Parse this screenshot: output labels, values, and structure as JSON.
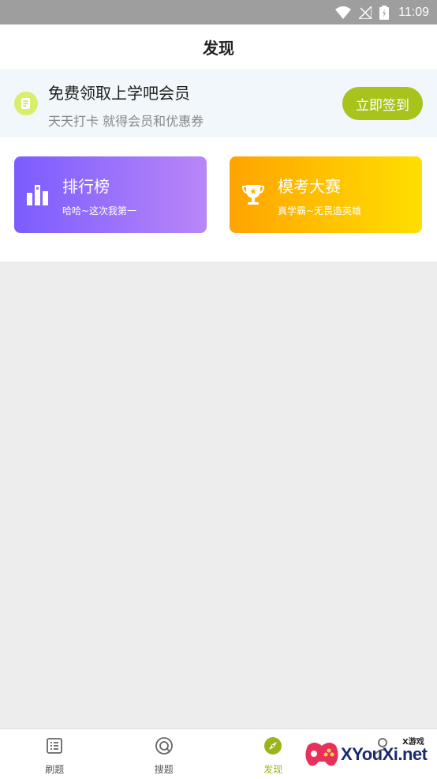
{
  "status_bar": {
    "time": "11:09"
  },
  "header": {
    "title": "发现"
  },
  "banner": {
    "title": "免费领取上学吧会员",
    "subtitle": "天天打卡 就得会员和优惠券",
    "button_label": "立即签到",
    "icon": "checkin-icon"
  },
  "cards": [
    {
      "title": "排行榜",
      "subtitle": "哈哈~这次我第一",
      "icon": "bar-chart-icon"
    },
    {
      "title": "模考大赛",
      "subtitle": "真学霸~无畏造英雄",
      "icon": "trophy-icon"
    }
  ],
  "nav": [
    {
      "label": "刷题",
      "icon": "list-icon",
      "active": false
    },
    {
      "label": "搜题",
      "icon": "search-icon",
      "active": false
    },
    {
      "label": "发现",
      "icon": "compass-icon",
      "active": true
    },
    {
      "label": "",
      "icon": "profile-icon",
      "active": false
    }
  ],
  "watermark": {
    "text": "XYouXi.net",
    "small": "X游戏"
  },
  "colors": {
    "accent": "#a8c41c",
    "rank_gradient": [
      "#7b5cff",
      "#b886f8"
    ],
    "exam_gradient": [
      "#ffa300",
      "#ffdf00"
    ]
  }
}
